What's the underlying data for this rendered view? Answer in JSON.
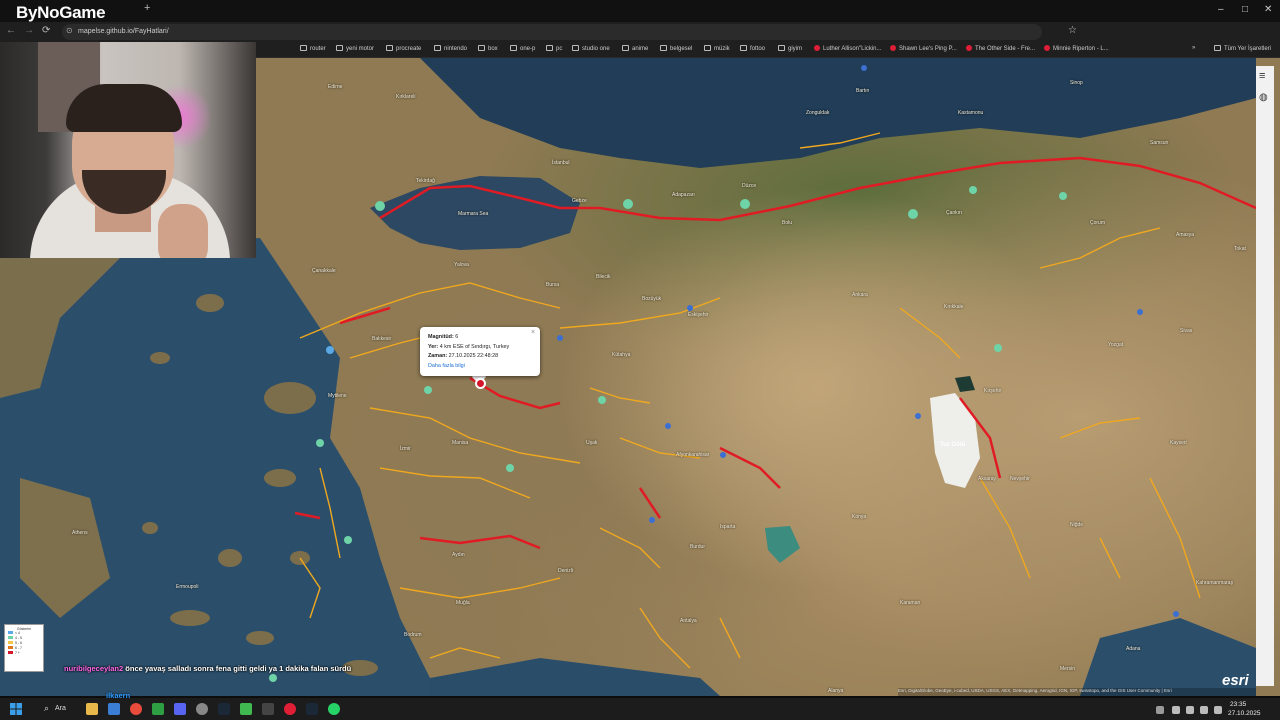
{
  "browser": {
    "brand": "ByNoGame",
    "url": "mapelse.github.io/FayHatlari/",
    "window_controls": [
      "–",
      "□",
      "✕"
    ],
    "bookmarks": [
      "router",
      "yeni motor",
      "procreate",
      "nintendo",
      "box",
      "one-p",
      "pc",
      "studio one",
      "anime",
      "belgesel",
      "müzik",
      "fottoo",
      "giyim",
      "Luther Allison\"Lickin...",
      "Shawn Lee's Ping P...",
      "The Other Side - Fre...",
      "Minnie Riperton - L...",
      "Tüm Yer İşaretleri"
    ]
  },
  "map": {
    "popup": {
      "magnitude_label": "Magnitüd:",
      "magnitude_value": "6",
      "location_label": "Yer:",
      "location_value": "4 km ESE of Sındırgı, Turkey",
      "time_label": "Zaman:",
      "time_value": "27.10.2025 22:48:28",
      "link": "Daha fazla bilgi"
    },
    "lake_label": "Tuz Gölü",
    "cities": [
      "Edirne",
      "Kırklareli",
      "Tekirdağ",
      "İstanbul",
      "Marmara Sea",
      "Gebze",
      "Adapazarı",
      "Düzce",
      "Bolu",
      "Zonguldak",
      "Bartın",
      "Kastamonu",
      "Sinop",
      "Samsun",
      "Çankırı",
      "Çorum",
      "Amasya",
      "Tokat",
      "Yalova",
      "Bursa",
      "Bilecik",
      "Eskişehir",
      "Bozüyük",
      "Çanakkale",
      "Balıkesir",
      "Kütahya",
      "Ankara",
      "Kırıkkale",
      "Kırşehir",
      "Yozgat",
      "Sivas",
      "Manisa",
      "İzmir",
      "Uşak",
      "Afyonkarahisar",
      "Aksaray",
      "Nevşehir",
      "Kayseri",
      "Aydın",
      "Denizli",
      "Isparta",
      "Konya",
      "Niğde",
      "Burdur",
      "Muğla",
      "Antalya",
      "Karaman",
      "Adana",
      "Kahramanmaraş",
      "Athens",
      "Mytilene",
      "Mersin",
      "Bodrum",
      "Alanya",
      "Ermoupoli"
    ],
    "legend": {
      "title": "Gösterim",
      "items": [
        {
          "label": "< 4",
          "color": "#5aa9e6"
        },
        {
          "label": "4 - 5",
          "color": "#6fd3a8"
        },
        {
          "label": "5 - 6",
          "color": "#f4c542"
        },
        {
          "label": "6 - 7",
          "color": "#e0791d"
        },
        {
          "label": "7 +",
          "color": "#d4162a"
        }
      ]
    },
    "attribution": "Esri, DigitalGlobe, GeoEye, i-cubed, USDA, USGS, AEX, Getmapping, Aerogrid, IGN, IGP, swisstopo, and the GIS User Community | Esri",
    "logo": "esri"
  },
  "chat": {
    "user": "nuribilgeceylan2",
    "message": "önce yavaş salladı sonra fena gitti geldi ya 1 dakika falan sürdü",
    "user2": "ilkaern"
  },
  "taskbar": {
    "search_label": "Ara",
    "time": "23:35",
    "date": "27.10.2025"
  }
}
